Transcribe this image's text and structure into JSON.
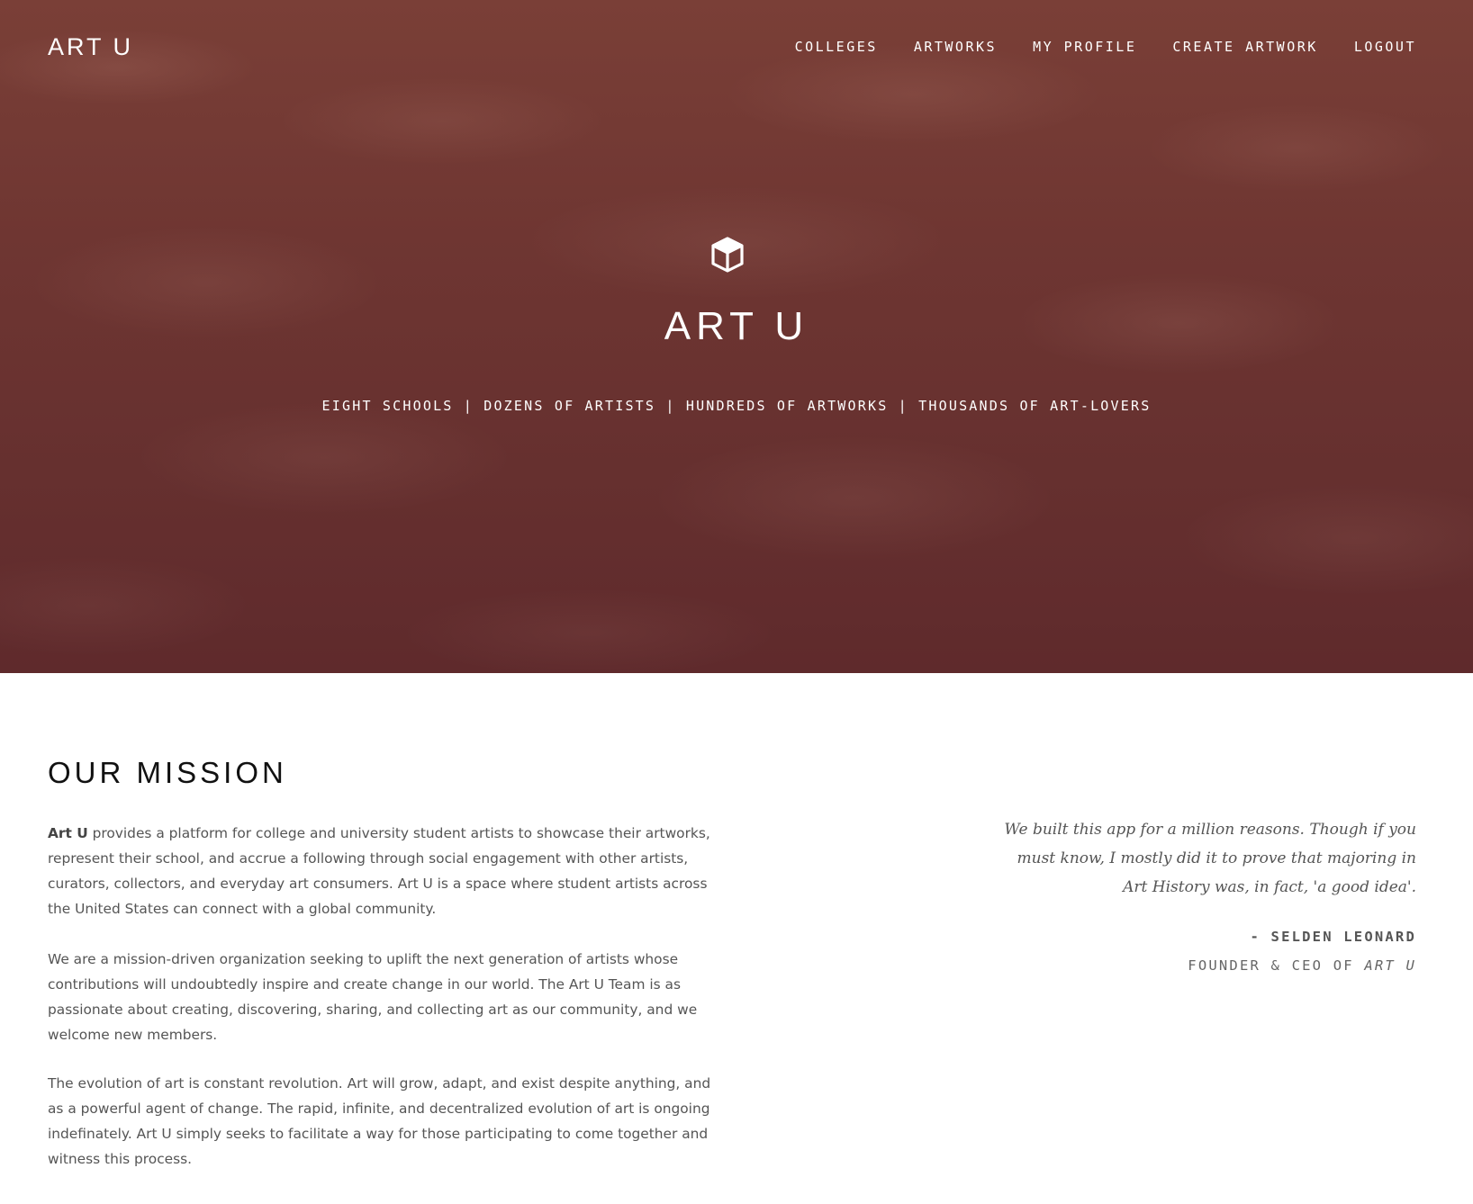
{
  "colors": {
    "hero_background": "#6b3431",
    "accent_text": "#ffffff",
    "body_text": "#555555",
    "heading_text": "#111111"
  },
  "nav": {
    "brand": "ART U",
    "links": [
      "COLLEGES",
      "ARTWORKS",
      "MY PROFILE",
      "CREATE ARTWORK",
      "LOGOUT"
    ]
  },
  "hero": {
    "icon": "cube-icon",
    "title": "ART U",
    "tagline": "EIGHT SCHOOLS | DOZENS OF ARTISTS | HUNDREDS OF ARTWORKS | THOUSANDS OF ART-LOVERS"
  },
  "mission": {
    "heading": "OUR MISSION",
    "p1_bold": "Art U",
    "p1_rest": " provides a platform for college and university student artists to showcase their artworks, represent their school, and accrue a following through social engagement with other artists, curators, collectors, and everyday art consumers. Art U is a space where student artists across the United States can connect with a global community.",
    "p2": "We are a mission-driven organization seeking to uplift the next generation of artists whose contributions will undoubtedly inspire and create change in our world. The Art U Team is as passionate about creating, discovering, sharing, and collecting art as our community, and we welcome new members.",
    "p3": "The evolution of art is constant revolution. Art will grow, adapt, and exist despite anything, and as a powerful agent of change. The rapid, infinite, and decentralized evolution of art is ongoing indefinately. Art U simply seeks to facilitate a way for those participating to come together and witness this process."
  },
  "quote": {
    "text": "We built this app for a million reasons. Though if you must know, I mostly did it to prove that majoring in Art History was, in fact, 'a good idea'.",
    "author": "- SELDEN LEONARD",
    "role_prefix": "FOUNDER & CEO OF ",
    "role_company": "ART U"
  }
}
